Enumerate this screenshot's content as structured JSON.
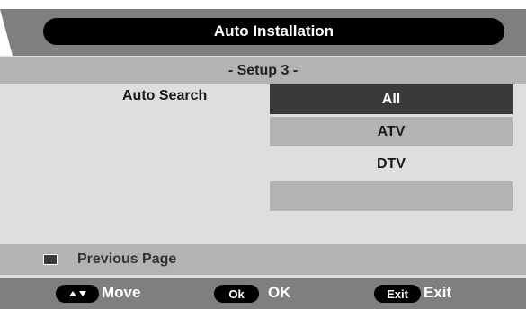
{
  "header": {
    "title": "Auto Installation",
    "subtitle": "- Setup 3 -"
  },
  "setting": {
    "label": "Auto Search",
    "options": [
      "All",
      "ATV",
      "DTV",
      ""
    ],
    "selected": "All"
  },
  "previous_page": {
    "label": "Previous Page"
  },
  "footer": {
    "move": {
      "button_icon": "up-down-arrows-icon",
      "label": "Move"
    },
    "ok": {
      "button_text": "Ok",
      "label": "OK"
    },
    "exit": {
      "button_text": "Exit",
      "label": "Exit"
    }
  },
  "colors": {
    "title_bar": "#000000",
    "band": "#7f7f7f",
    "panel": "#dedede",
    "row_alt": "#b3b3b3",
    "selected": "#3a3a3a"
  }
}
